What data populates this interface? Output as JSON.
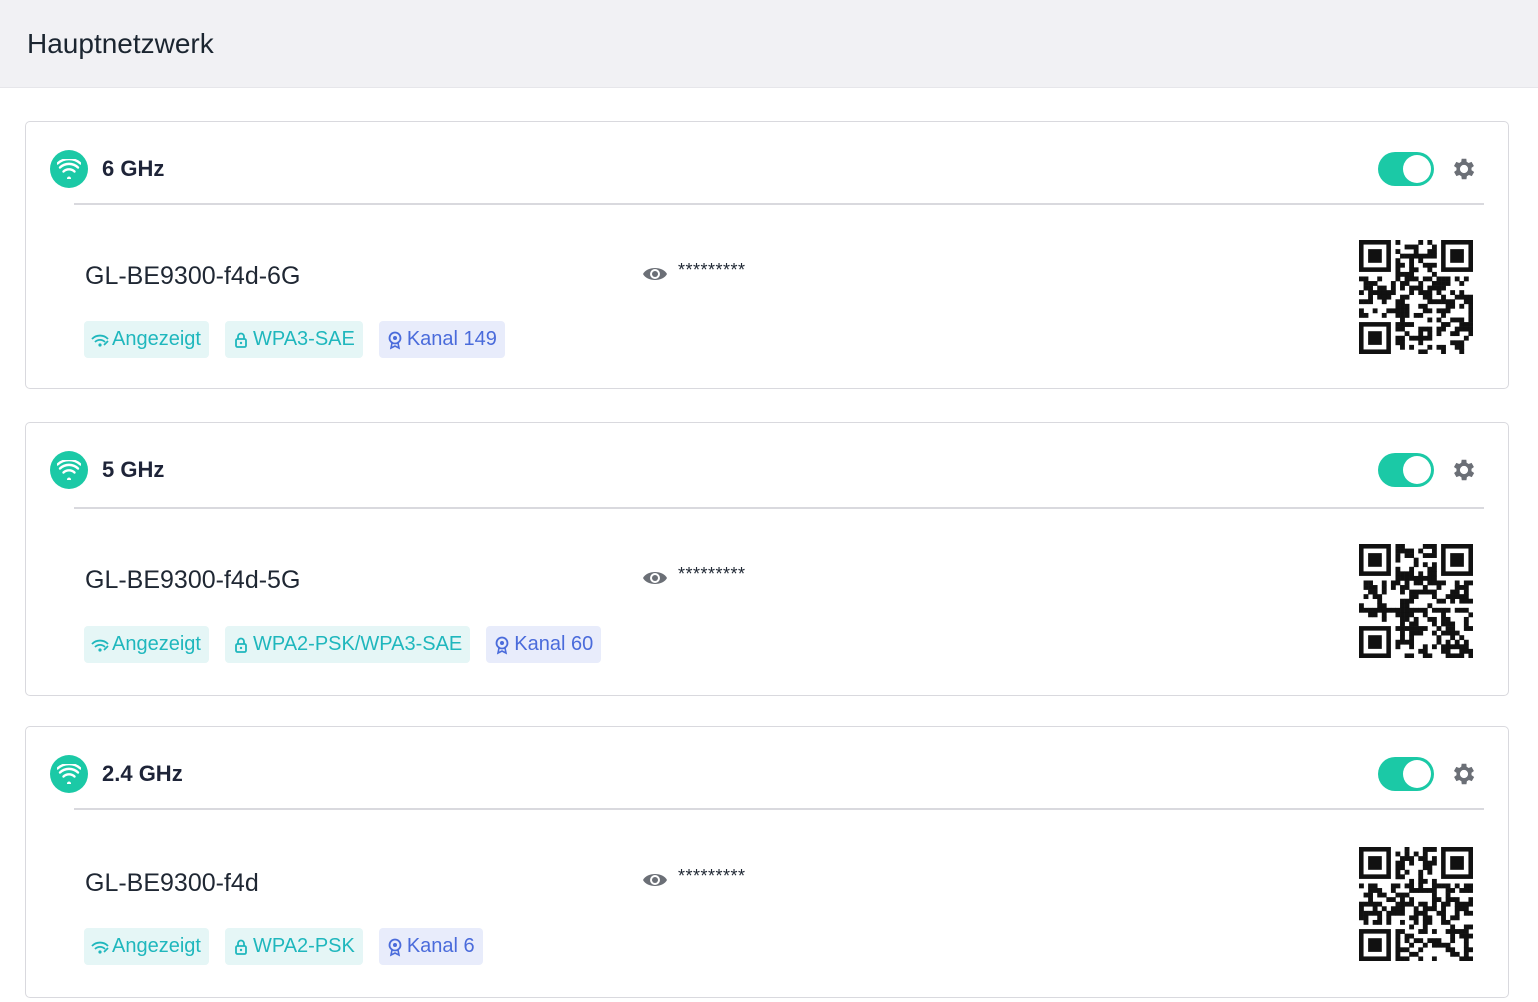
{
  "page": {
    "title": "Hauptnetzwerk"
  },
  "colors": {
    "accent": "#1bc9a6",
    "tag_teal_text": "#1fb7bd",
    "tag_blue_text": "#4a6bdb"
  },
  "networks": [
    {
      "band": "6 GHz",
      "enabled": true,
      "ssid": "GL-BE9300-f4d-6G",
      "password_masked": "*********",
      "tags": {
        "visibility": "Angezeigt",
        "security": "WPA3-SAE",
        "channel": "Kanal 149"
      }
    },
    {
      "band": "5 GHz",
      "enabled": true,
      "ssid": "GL-BE9300-f4d-5G",
      "password_masked": "*********",
      "tags": {
        "visibility": "Angezeigt",
        "security": "WPA2-PSK/WPA3-SAE",
        "channel": "Kanal 60"
      }
    },
    {
      "band": "2.4 GHz",
      "enabled": true,
      "ssid": "GL-BE9300-f4d",
      "password_masked": "*********",
      "tags": {
        "visibility": "Angezeigt",
        "security": "WPA2-PSK",
        "channel": "Kanal 6"
      }
    }
  ]
}
